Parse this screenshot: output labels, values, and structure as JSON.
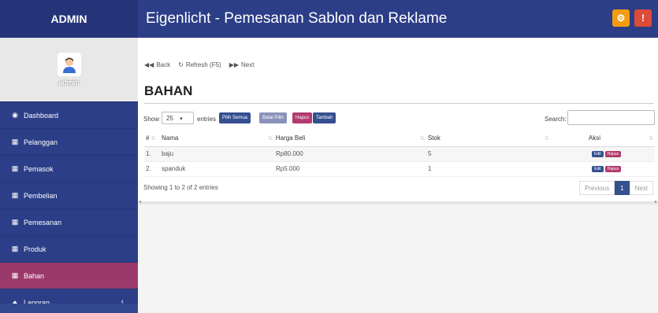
{
  "brand": "ADMIN",
  "app_title": "Eigenlicht - Pemesanan Sablon dan Reklame",
  "user": {
    "name": "admin"
  },
  "sidebar": {
    "items": [
      {
        "label": "Dashboard",
        "icon": "dashboard-icon"
      },
      {
        "label": "Pelanggan",
        "icon": "table-icon"
      },
      {
        "label": "Pemasok",
        "icon": "table-icon"
      },
      {
        "label": "Pembelian",
        "icon": "table-icon"
      },
      {
        "label": "Pemesanan",
        "icon": "table-icon"
      },
      {
        "label": "Produk",
        "icon": "table-icon"
      },
      {
        "label": "Bahan",
        "icon": "table-icon",
        "active": true
      },
      {
        "label": "Laporan",
        "icon": "sitemap-icon"
      }
    ]
  },
  "nav": {
    "back": "Back",
    "refresh": "Refresh (F5)",
    "next": "Next"
  },
  "page_title": "BAHAN",
  "controls": {
    "show": "Show",
    "entries_value": "25",
    "entries": "entries",
    "btn_pilih_semua": "Pilih Semua",
    "btn_batal_pilih": "Batal Pilih",
    "btn_hapus": "Hapus",
    "btn_tambah": "Tambah",
    "search_label": "Search:"
  },
  "table": {
    "headers": [
      "#",
      "Nama",
      "Harga Beli",
      "Stok",
      "Aksi"
    ],
    "rows": [
      {
        "no": "1.",
        "nama": "baju",
        "harga": "Rp80.000",
        "stok": "5"
      },
      {
        "no": "2.",
        "nama": "spanduk",
        "harga": "Rp5.000",
        "stok": "1"
      }
    ],
    "edit_label": "Edit",
    "hapus_label": "Hapus"
  },
  "info": "Showing 1 to 2 of 2 entries",
  "pager": {
    "previous": "Previous",
    "current": "1",
    "next": "Next"
  },
  "colors": {
    "primary": "#2c3e88",
    "active": "#9b3a6a",
    "warning": "#f39c12",
    "danger": "#dd4b39"
  }
}
